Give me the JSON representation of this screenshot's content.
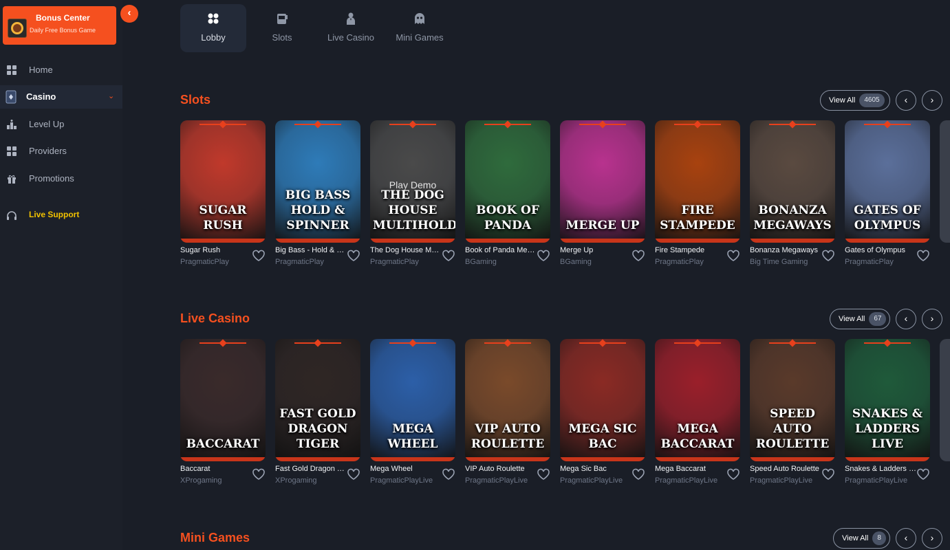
{
  "sidebar": {
    "bonus_title": "Bonus Center",
    "bonus_sub": "Daily Free Bonus Game",
    "collapse_icon": "‹",
    "items": [
      {
        "label": "Home",
        "icon": "grid-icon"
      },
      {
        "label": "Casino",
        "icon": "cards-icon",
        "active": true
      },
      {
        "label": "Level Up",
        "icon": "podium-icon"
      },
      {
        "label": "Providers",
        "icon": "grid-icon"
      },
      {
        "label": "Promotions",
        "icon": "gift-icon"
      }
    ],
    "support": "Live Support"
  },
  "tabs": [
    {
      "label": "Lobby",
      "icon": "grid-icon"
    },
    {
      "label": "Slots",
      "icon": "slot-machine-icon"
    },
    {
      "label": "Live Casino",
      "icon": "dealer-icon"
    },
    {
      "label": "Mini Games",
      "icon": "ghost-icon"
    }
  ],
  "sections": [
    {
      "title": "Slots",
      "view_all": "View All",
      "count": "4605",
      "games": [
        {
          "title": "SUGAR RUSH",
          "name": "Sugar Rush",
          "provider": "PragmaticPlay",
          "bg": "#c0392b"
        },
        {
          "title": "BIG BASS HOLD & SPINNER",
          "name": "Big Bass - Hold & Spinner",
          "provider": "PragmaticPlay",
          "bg": "#2e7bb8"
        },
        {
          "title": "THE DOG HOUSE MULTIHOLD",
          "name": "The Dog House Multihold",
          "provider": "PragmaticPlay",
          "bg": "#4a4a4a",
          "demo": "Play Demo"
        },
        {
          "title": "BOOK OF PANDA",
          "name": "Book of Panda Megaways",
          "provider": "BGaming",
          "bg": "#2f6b3c"
        },
        {
          "title": "MERGE UP",
          "name": "Merge Up",
          "provider": "BGaming",
          "bg": "#b8328e"
        },
        {
          "title": "FIRE STAMPEDE",
          "name": "Fire Stampede",
          "provider": "PragmaticPlay",
          "bg": "#a8420f"
        },
        {
          "title": "BONANZA MEGAWAYS",
          "name": "Bonanza Megaways",
          "provider": "Big Time Gaming",
          "bg": "#5a4a40"
        },
        {
          "title": "GATES OF OLYMPUS",
          "name": "Gates of Olympus",
          "provider": "PragmaticPlay",
          "bg": "#5b6f9a"
        }
      ]
    },
    {
      "title": "Live Casino",
      "view_all": "View All",
      "count": "67",
      "games": [
        {
          "title": "BACCARAT",
          "name": "Baccarat",
          "provider": "XProgaming",
          "bg": "#3a2a2a"
        },
        {
          "title": "FAST GOLD DRAGON TIGER",
          "name": "Fast Gold Dragon Tiger",
          "provider": "XProgaming",
          "bg": "#2f2624"
        },
        {
          "title": "MEGA WHEEL",
          "name": "Mega Wheel",
          "provider": "PragmaticPlayLive",
          "bg": "#2c5fa8"
        },
        {
          "title": "VIP AUTO ROULETTE",
          "name": "VIP Auto Roulette",
          "provider": "PragmaticPlayLive",
          "bg": "#7a4a2a"
        },
        {
          "title": "MEGA SIC BAC",
          "name": "Mega Sic Bac",
          "provider": "PragmaticPlayLive",
          "bg": "#8a2a24"
        },
        {
          "title": "MEGA BACCARAT",
          "name": "Mega Baccarat",
          "provider": "PragmaticPlayLive",
          "bg": "#9a1f2a"
        },
        {
          "title": "SPEED AUTO ROULETTE",
          "name": "Speed Auto Roulette",
          "provider": "PragmaticPlayLive",
          "bg": "#5a3a2a"
        },
        {
          "title": "SNAKES & LADDERS LIVE",
          "name": "Snakes & Ladders Live",
          "provider": "PragmaticPlayLive",
          "bg": "#1f5a3a"
        }
      ]
    },
    {
      "title": "Mini Games",
      "view_all": "View All",
      "count": "8"
    }
  ]
}
